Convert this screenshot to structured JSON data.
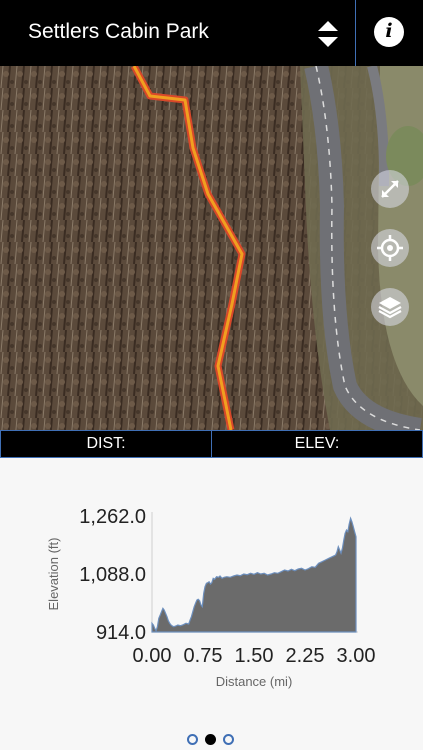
{
  "header": {
    "title": "Settlers Cabin Park",
    "info_label": "i"
  },
  "stats": {
    "dist_label": "DIST:",
    "elev_label": "ELEV:"
  },
  "map_controls": {
    "expand": "expand-icon",
    "locate": "locate-crosshair-icon",
    "layers": "layers-icon"
  },
  "colors": {
    "trail": "#f0a020",
    "trail_outline": "#d8482a",
    "accent": "#3f6fb5"
  },
  "chart_data": {
    "type": "area",
    "xlabel": "Distance (mi)",
    "ylabel": "Elevation (ft)",
    "xlim": [
      0,
      3
    ],
    "ylim": [
      914,
      1262
    ],
    "x_ticks": [
      "0.00",
      "0.75",
      "1.50",
      "2.25",
      "3.00"
    ],
    "y_ticks": [
      "914.0",
      "1,088.0",
      "1,262.0"
    ],
    "series": [
      {
        "x": [
          0.0,
          0.02,
          0.04,
          0.06,
          0.08,
          0.1,
          0.12,
          0.14,
          0.16,
          0.18,
          0.2,
          0.22,
          0.24,
          0.26,
          0.28,
          0.3,
          0.32,
          0.35,
          0.38,
          0.42,
          0.46,
          0.5,
          0.54,
          0.56,
          0.58,
          0.6,
          0.62,
          0.64,
          0.66,
          0.68,
          0.7,
          0.72,
          0.74,
          0.76,
          0.78,
          0.8,
          0.82,
          0.84,
          0.86,
          0.88,
          0.9,
          0.92,
          0.95,
          0.98,
          1.0,
          1.03,
          1.06,
          1.1,
          1.15,
          1.2,
          1.25,
          1.3,
          1.35,
          1.4,
          1.45,
          1.5,
          1.55,
          1.6,
          1.65,
          1.7,
          1.75,
          1.8,
          1.85,
          1.9,
          1.95,
          2.0,
          2.05,
          2.1,
          2.15,
          2.2,
          2.25,
          2.3,
          2.35,
          2.4,
          2.45,
          2.5,
          2.55,
          2.6,
          2.65,
          2.7,
          2.72,
          2.74,
          2.76,
          2.78,
          2.8,
          2.82,
          2.84,
          2.86,
          2.88,
          2.9,
          2.92,
          2.94,
          2.96,
          2.98,
          3.0
        ],
        "y": [
          940,
          935,
          925,
          918,
          930,
          955,
          965,
          975,
          985,
          980,
          970,
          960,
          948,
          940,
          935,
          932,
          930,
          932,
          935,
          933,
          936,
          940,
          938,
          950,
          960,
          975,
          990,
          1000,
          1010,
          1012,
          1008,
          995,
          990,
          1030,
          1050,
          1060,
          1062,
          1065,
          1058,
          1062,
          1075,
          1072,
          1080,
          1078,
          1082,
          1075,
          1078,
          1080,
          1078,
          1082,
          1085,
          1083,
          1088,
          1086,
          1090,
          1087,
          1092,
          1088,
          1090,
          1085,
          1088,
          1092,
          1090,
          1095,
          1100,
          1097,
          1102,
          1098,
          1103,
          1105,
          1100,
          1104,
          1110,
          1108,
          1120,
          1125,
          1130,
          1135,
          1140,
          1145,
          1155,
          1170,
          1160,
          1150,
          1165,
          1190,
          1210,
          1220,
          1215,
          1238,
          1255,
          1245,
          1230,
          1215,
          1200
        ]
      }
    ]
  }
}
